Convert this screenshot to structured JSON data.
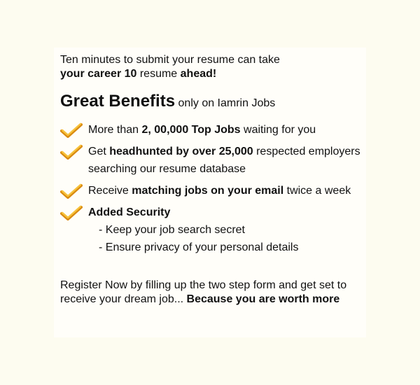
{
  "intro": {
    "line1": "Ten minutes to submit your resume can take",
    "line2_bold1": "your career 10",
    "line2_mid": " resume ",
    "line2_bold2": "ahead!"
  },
  "heading": {
    "title": "Great Benefits",
    "subtitle": "only on Iamrin Jobs"
  },
  "benefits": [
    {
      "pre": "More than ",
      "bold": "2, 00,000 Top Jobs",
      "post": " waiting for you"
    },
    {
      "pre": "Get ",
      "bold": "headhunted by over 25,000",
      "post": " respected employers searching our resume database"
    },
    {
      "pre": "Receive ",
      "bold": "matching jobs on your email",
      "post": " twice a week"
    },
    {
      "bold": "Added Security",
      "subitems": [
        "- Keep your job search secret",
        "- Ensure privacy of your personal details"
      ]
    }
  ],
  "footer": {
    "text": "Register Now by filling up the two step form and get set to receive your dream job... ",
    "bold": "Because you are worth more"
  },
  "colors": {
    "background": "#fdfcf0",
    "check_light": "#f7c23a",
    "check_dark": "#d98a10"
  },
  "icons": {
    "benefit": "checkmark-icon"
  }
}
